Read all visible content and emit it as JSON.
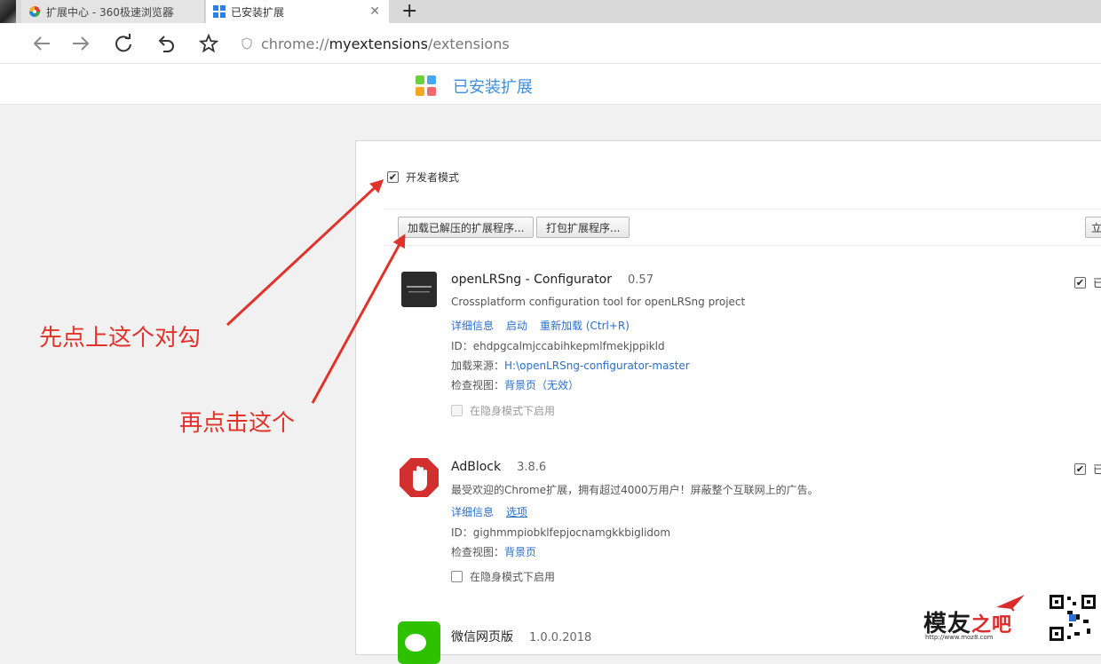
{
  "tabs": [
    {
      "title": "扩展中心 - 360极速浏览器",
      "active": false
    },
    {
      "title": "已安装扩展",
      "active": true
    }
  ],
  "toolbar": {
    "address_prefix": "chrome://",
    "address_host": "myextensions",
    "address_path": "/extensions"
  },
  "page": {
    "title": "已安装扩展"
  },
  "developer_mode": {
    "label": "开发者模式",
    "checked": true
  },
  "buttons": {
    "load_unpacked": "加载已解压的扩展程序...",
    "pack": "打包扩展程序...",
    "update_partial": "立"
  },
  "extensions": [
    {
      "name": "openLRSng - Configurator",
      "version": "0.57",
      "description": "Crossplatform configuration tool for openLRSng project",
      "links": [
        "详细信息",
        "启动",
        "重新加载 (Ctrl+R)"
      ],
      "id_label": "ID：",
      "id": "ehdpgcalmjccabihkepmlfmekjppikld",
      "source_label": "加载来源：",
      "source": "H:\\openLRSng-configurator-master",
      "inspect_label": "检查视图：",
      "inspect_link": "背景页（无效）",
      "incognito_label": "在隐身模式下启用",
      "enabled_label": "已",
      "enabled": true
    },
    {
      "name": "AdBlock",
      "version": "3.8.6",
      "description": "最受欢迎的Chrome扩展，拥有超过4000万用户！屏蔽整个互联网上的广告。",
      "links": [
        "详细信息",
        "选项"
      ],
      "id_label": "ID：",
      "id": "gighmmpiobklfepjocnamgkkbiglidom",
      "inspect_label": "检查视图：",
      "inspect_link": "背景页",
      "incognito_label": "在隐身模式下启用",
      "enabled_label": "已",
      "enabled": true
    },
    {
      "name": "微信网页版",
      "version": "1.0.0.2018"
    }
  ],
  "annotations": {
    "first": "先点上这个对勾",
    "second": "再点击这个"
  },
  "watermark": {
    "brand": "模友",
    "brand_suffix": "之吧",
    "url": "http://www.moz8.com"
  },
  "colors": {
    "accent": "#3b8fe0",
    "link": "#2a6fce",
    "annotation": "#e0332b"
  }
}
